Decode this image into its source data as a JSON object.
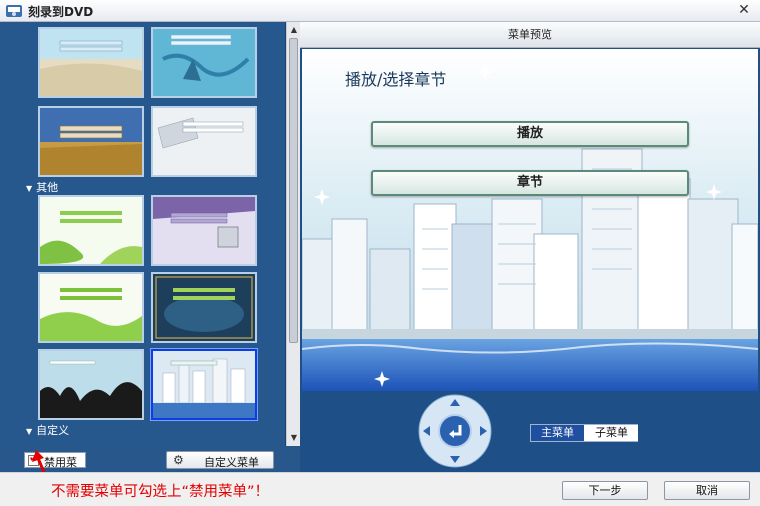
{
  "window": {
    "title": "刻录到DVD",
    "close_glyph": "✕"
  },
  "left_panel": {
    "groups": [
      {
        "label": "其他"
      },
      {
        "label": "自定义"
      }
    ],
    "disable_menu": {
      "label": "禁用菜单",
      "checked": true
    },
    "custom_menu_button": {
      "label": "自定义菜单"
    }
  },
  "preview": {
    "header": "菜单预览",
    "title": "播放/选择章节",
    "play_button": "播放",
    "chapter_button": "章节"
  },
  "tabs": {
    "main": "主菜单",
    "sub": "子菜单"
  },
  "footer": {
    "annotation": "不需要菜单可勾选上“禁用菜单”！",
    "next_button": "下一步",
    "cancel_button": "取消"
  },
  "colors": {
    "annotation": "#e30000",
    "panel": "#26588d",
    "selected_border": "#0d3fe0"
  }
}
